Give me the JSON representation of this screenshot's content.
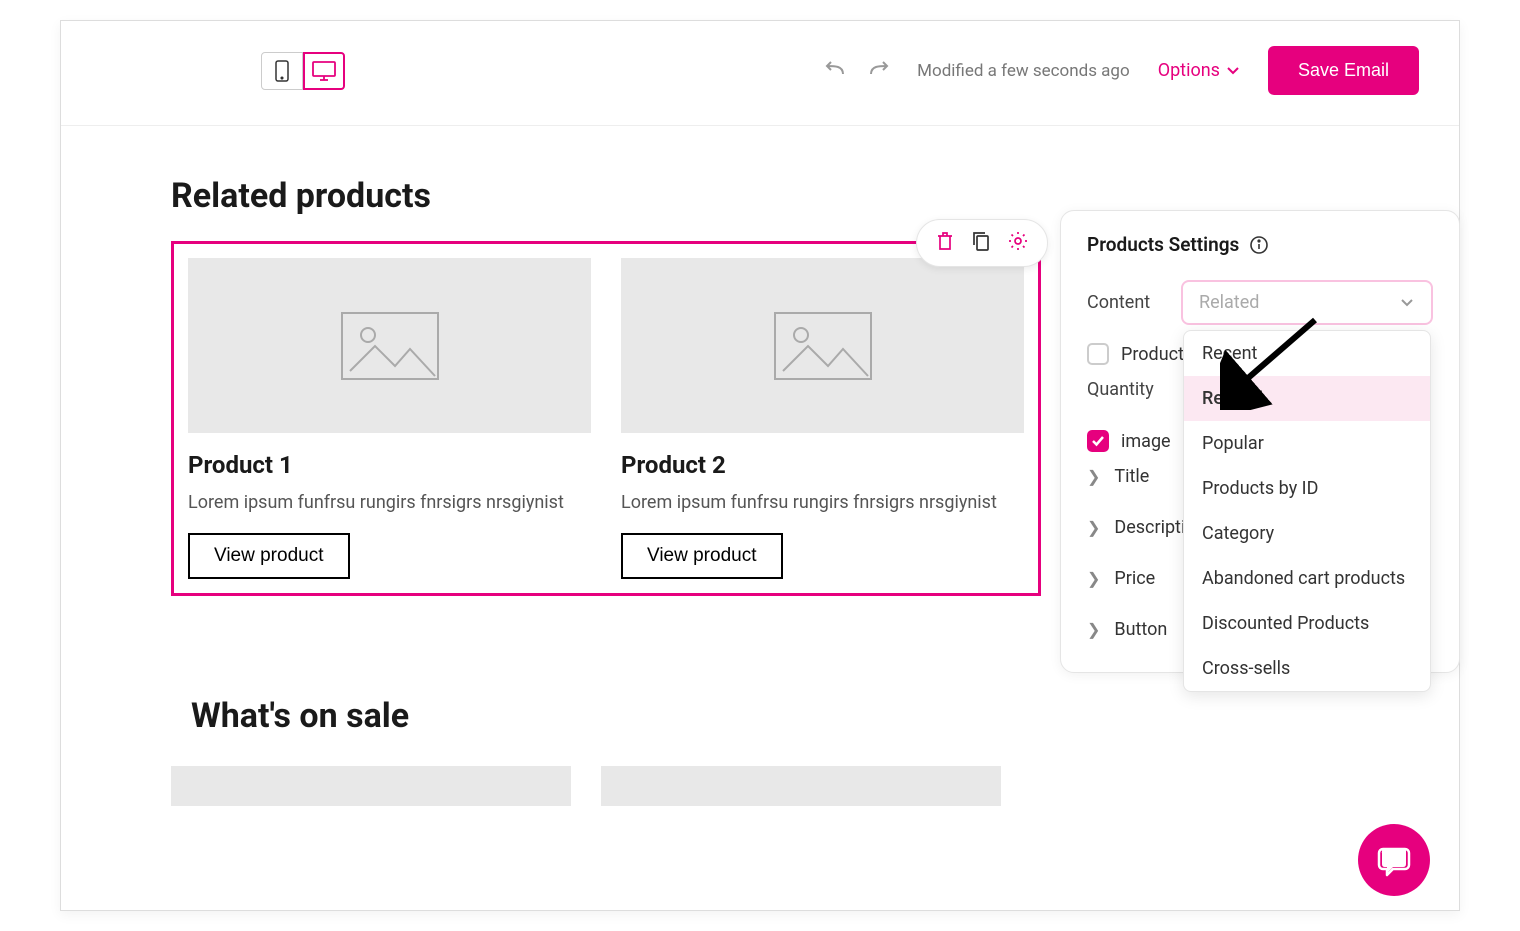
{
  "toolbar": {
    "modified": "Modified a few seconds ago",
    "options": "Options",
    "save": "Save Email"
  },
  "sections": {
    "related_title": "Related products",
    "sale_title": "What's on sale"
  },
  "products": [
    {
      "title": "Product 1",
      "desc": "Lorem ipsum funfrsu rungirs fnrsigrs nrsgiynist",
      "button": "View product"
    },
    {
      "title": "Product 2",
      "desc": "Lorem ipsum funfrsu rungirs fnrsigrs nrsgiynist",
      "button": "View product"
    }
  ],
  "settings": {
    "header": "Products Settings",
    "content_label": "Content",
    "content_value": "Related",
    "product_order": "Product order",
    "quantity": "Quantity",
    "image_label": "image",
    "rows": {
      "title": "Title",
      "description": "Description",
      "price": "Price",
      "button": "Button"
    },
    "dropdown": [
      "Recent",
      "Related",
      "Popular",
      "Products by ID",
      "Category",
      "Abandoned cart products",
      "Discounted Products",
      "Cross-sells"
    ]
  }
}
